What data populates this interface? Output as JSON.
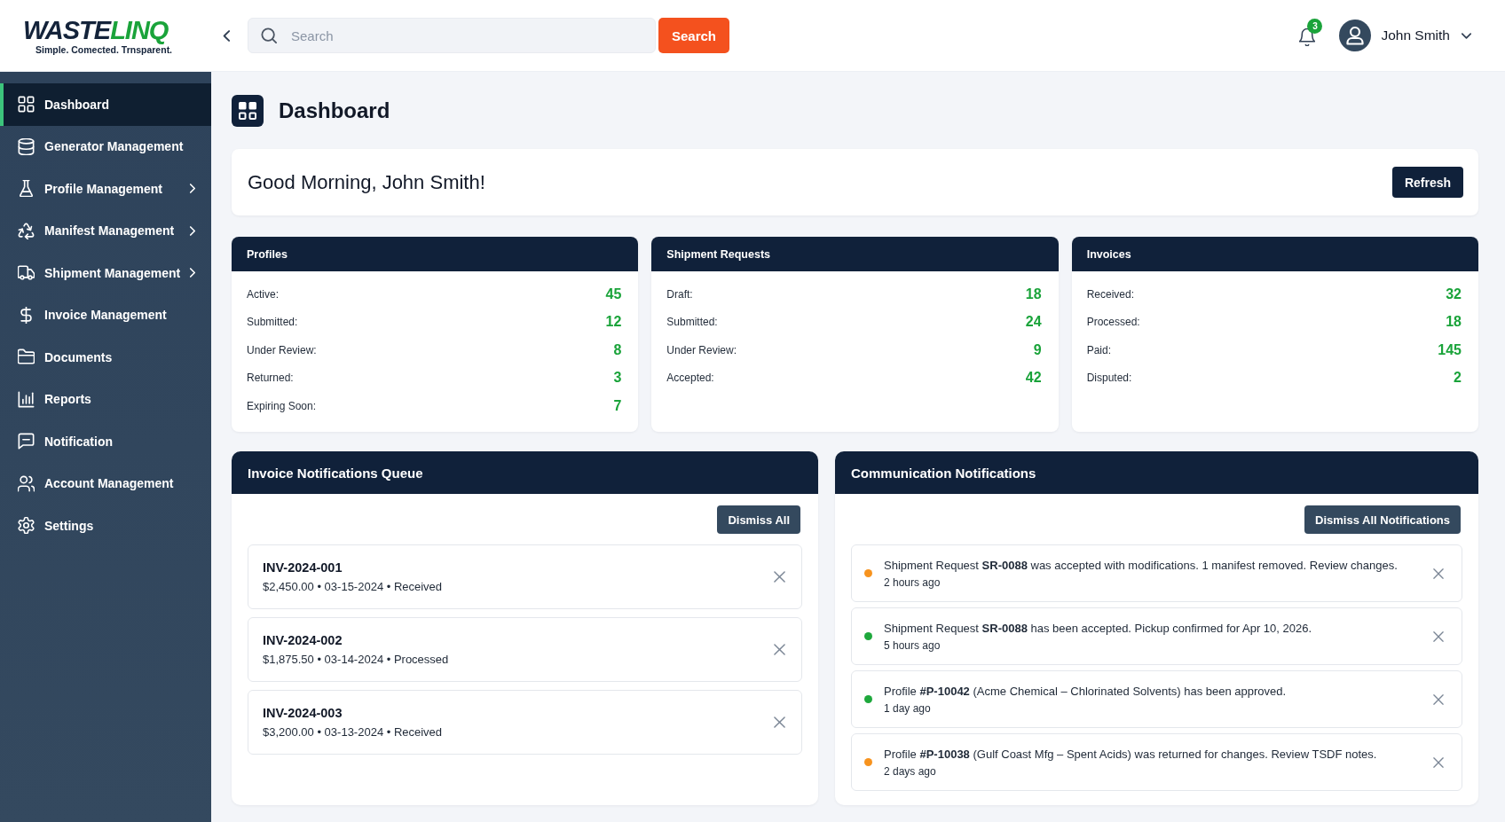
{
  "header": {
    "logo": {
      "name_dark": "WASTE",
      "name_accent": "LINQ",
      "tagline": "Simple. Comected. Trnsparent."
    },
    "search": {
      "placeholder": "Search",
      "button": "Search"
    },
    "notifications_badge": "3",
    "user": {
      "name": "John Smith"
    }
  },
  "sidebar": {
    "items": [
      {
        "label": "Dashboard",
        "selected": true,
        "has_submenu": false
      },
      {
        "label": "Generator Management",
        "selected": false,
        "has_submenu": false
      },
      {
        "label": "Profile Management",
        "selected": false,
        "has_submenu": true
      },
      {
        "label": "Manifest Management",
        "selected": false,
        "has_submenu": true
      },
      {
        "label": "Shipment Management",
        "selected": false,
        "has_submenu": true
      },
      {
        "label": "Invoice Management",
        "selected": false,
        "has_submenu": false
      },
      {
        "label": "Documents",
        "selected": false,
        "has_submenu": false
      },
      {
        "label": "Reports",
        "selected": false,
        "has_submenu": false
      },
      {
        "label": "Notification",
        "selected": false,
        "has_submenu": false
      },
      {
        "label": "Account Management",
        "selected": false,
        "has_submenu": false
      },
      {
        "label": "Settings",
        "selected": false,
        "has_submenu": false
      }
    ]
  },
  "page": {
    "title": "Dashboard"
  },
  "greeting": {
    "text": "Good Morning, John Smith!",
    "button": "Refresh"
  },
  "stat_cards": [
    {
      "title": "Profiles",
      "rows": [
        {
          "label": "Active:",
          "value": "45"
        },
        {
          "label": "Submitted:",
          "value": "12"
        },
        {
          "label": "Under Review:",
          "value": "8"
        },
        {
          "label": "Returned:",
          "value": "3"
        },
        {
          "label": "Expiring Soon:",
          "value": "7"
        }
      ]
    },
    {
      "title": "Shipment Requests",
      "rows": [
        {
          "label": "Draft:",
          "value": "18"
        },
        {
          "label": "Submitted:",
          "value": "24"
        },
        {
          "label": "Under Review:",
          "value": "9"
        },
        {
          "label": "Accepted:",
          "value": "42"
        }
      ]
    },
    {
      "title": "Invoices",
      "rows": [
        {
          "label": "Received:",
          "value": "32"
        },
        {
          "label": "Processed:",
          "value": "18"
        },
        {
          "label": "Paid:",
          "value": "145"
        },
        {
          "label": "Disputed:",
          "value": "2"
        }
      ]
    }
  ],
  "invoice_queue": {
    "title": "Invoice Notifications Queue",
    "button": "Dismiss All",
    "items": [
      {
        "id": "INV-2024-001",
        "details": "$2,450.00 • 03-15-2024 • Received"
      },
      {
        "id": "INV-2024-002",
        "details": "$1,875.50 • 03-14-2024 • Processed"
      },
      {
        "id": "INV-2024-003",
        "details": "$3,200.00 • 03-13-2024 • Received"
      }
    ]
  },
  "communication": {
    "title": "Communication Notifications",
    "button": "Dismiss All Notifications",
    "items": [
      {
        "color": "#f7931e",
        "message": "Shipment Request **SR-0088** was accepted with modifications. 1 manifest removed. Review changes.",
        "time": "2 hours ago"
      },
      {
        "color": "#1ea83c",
        "message": "Shipment Request **SR-0088** has been accepted. Pickup confirmed for Apr 10, 2026.",
        "time": "5 hours ago"
      },
      {
        "color": "#1ea83c",
        "message": "Profile **#P-10042** (Acme Chemical – Chlorinated Solvents) has been approved.",
        "time": "1 day ago"
      },
      {
        "color": "#f7931e",
        "message": "Profile **#P-10038** (Gulf Coast Mfg – Spent Acids) was returned for changes. Review TSDF notes.",
        "time": "2 days ago"
      }
    ]
  }
}
